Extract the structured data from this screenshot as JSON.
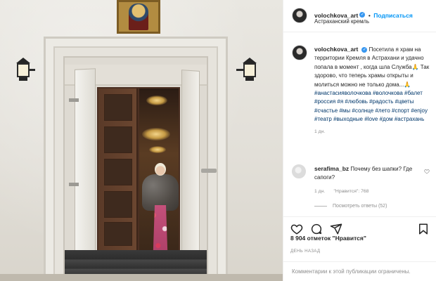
{
  "post": {
    "author": "volochkova_art",
    "follow_label": "Подписаться",
    "location": "Астраханский кремль",
    "caption_text": "Посетила я храм на территории Кремля в Астрахани и удачно попала в момент , когда шла Служба🙏 Так здорово, что теперь храмы открыты и молиться можно не только дома...🙏",
    "hashtags": "#анастасияволочкова #волочкова #балет #россия #я #любовь #радость #цветы #счастье #мы #солнце #лето #спорт #enjoy #театр #выходные #love #дом #астрахань",
    "caption_age": "1 дн."
  },
  "comment": {
    "author": "serafima_bz",
    "text": "Почему без шапки? Где сапоги?",
    "age": "1 дн.",
    "likes_label": "\"Нравится\": 768",
    "view_replies": "Посмотреть ответы (52)"
  },
  "footer": {
    "likes_text": "8 904 отметок \"Нравится\"",
    "time_ago": "День назад",
    "comments_disabled": "Комментарии к этой публикации ограничены."
  },
  "colors": {
    "link_blue": "#0095f6",
    "hashtag_blue": "#00376b",
    "muted_gray": "#8e8e8e"
  },
  "icons": [
    "verified-badge-icon",
    "heart-icon",
    "comment-icon",
    "share-icon",
    "bookmark-icon"
  ]
}
